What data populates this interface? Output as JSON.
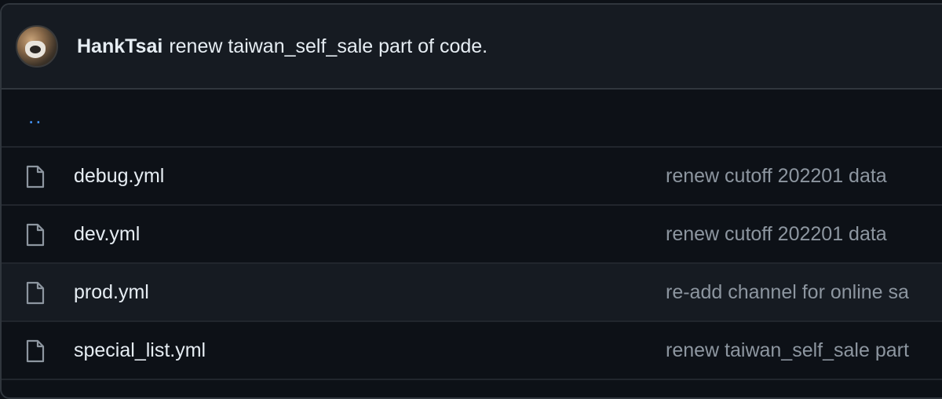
{
  "commit": {
    "author": "HankTsai",
    "message": "renew taiwan_self_sale part of code."
  },
  "parent_dir": "..",
  "files": [
    {
      "name": "debug.yml",
      "message": "renew cutoff 202201 data",
      "icon": "file-icon"
    },
    {
      "name": "dev.yml",
      "message": "renew cutoff 202201 data",
      "icon": "file-icon"
    },
    {
      "name": "prod.yml",
      "message": "re-add channel for online sa",
      "icon": "file-icon"
    },
    {
      "name": "special_list.yml",
      "message": "renew taiwan_self_sale part",
      "icon": "file-icon"
    }
  ],
  "colors": {
    "background": "#0d1117",
    "header": "#161b22",
    "border": "#30363d",
    "link": "#4493f8",
    "muted": "#8d96a0"
  }
}
